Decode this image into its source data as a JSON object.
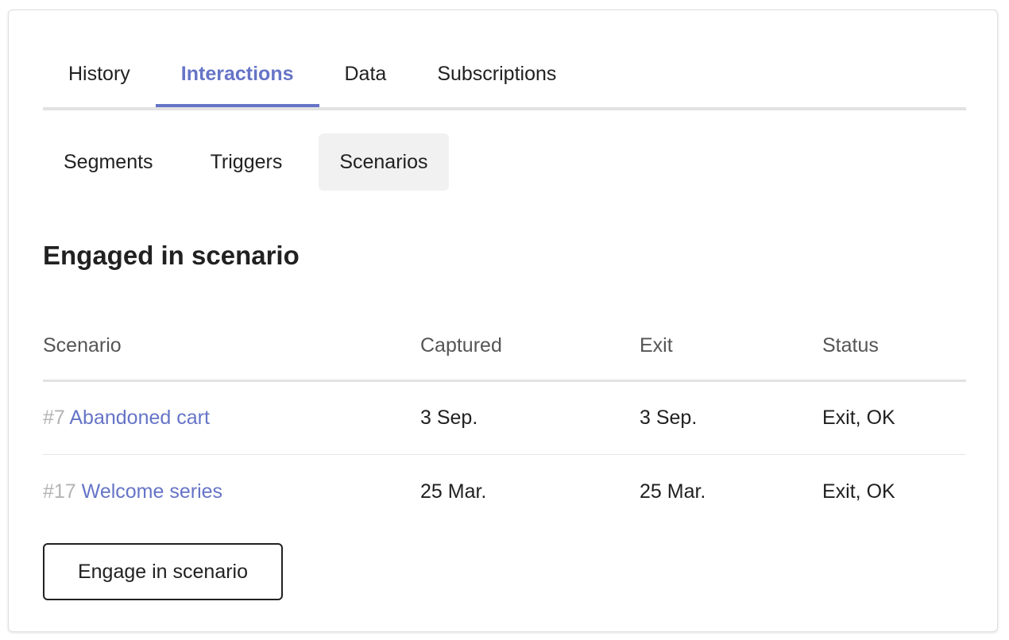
{
  "tabs": [
    {
      "label": "History",
      "active": false
    },
    {
      "label": "Interactions",
      "active": true
    },
    {
      "label": "Data",
      "active": false
    },
    {
      "label": "Subscriptions",
      "active": false
    }
  ],
  "subtabs": [
    {
      "label": "Segments",
      "selected": false
    },
    {
      "label": "Triggers",
      "selected": false
    },
    {
      "label": "Scenarios",
      "selected": true
    }
  ],
  "section": {
    "title": "Engaged in scenario"
  },
  "table": {
    "headers": [
      "Scenario",
      "Captured",
      "Exit",
      "Status"
    ],
    "rows": [
      {
        "id": "#7",
        "name": "Abandoned cart",
        "captured": "3 Sep.",
        "exit": "3 Sep.",
        "status": "Exit, OK"
      },
      {
        "id": "#17",
        "name": "Welcome series",
        "captured": "25 Mar.",
        "exit": "25 Mar.",
        "status": "Exit, OK"
      }
    ]
  },
  "actions": {
    "engage_label": "Engage in scenario"
  },
  "colors": {
    "accent": "#6674c7",
    "muted_id": "#b3b3b3",
    "selected_subtab_bg": "#f1f1f1"
  }
}
